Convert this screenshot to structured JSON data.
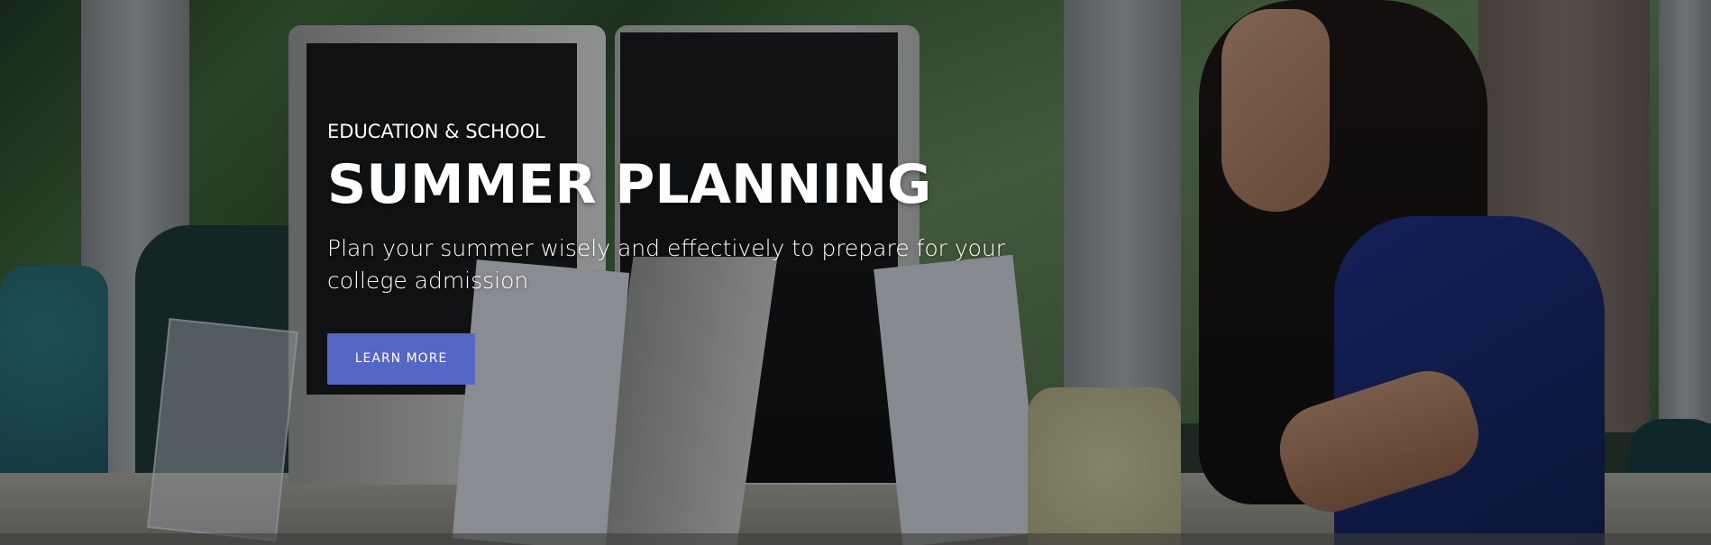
{
  "hero": {
    "eyebrow": "EDUCATION & SCHOOL",
    "title": "SUMMER PLANNING",
    "subtitle": "Plan your summer wisely and effectively to prepare for your college admission",
    "cta_label": "LEARN MORE"
  },
  "colors": {
    "cta_background": "#5566c4",
    "text": "#ffffff",
    "overlay": "rgba(10, 14, 20, 0.42)"
  }
}
